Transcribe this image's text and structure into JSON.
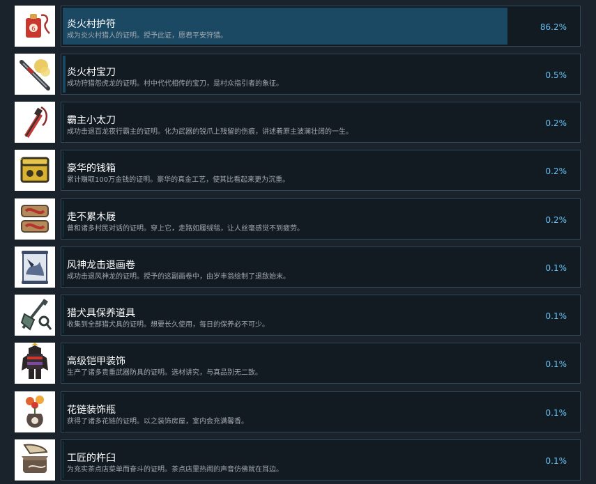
{
  "achievements": [
    {
      "title": "炎火村护符",
      "desc": "成为炎火村猎人的证明。授予此证，愿君平安狩猎。",
      "percent": "86.2%",
      "fill_fraction": 0.862,
      "icon": "red-charm-amulet-icon"
    },
    {
      "title": "炎火村宝刀",
      "desc": "成功狩猎怨虎龙的证明。村中代代相传的宝刀，是村众指引者的象征。",
      "percent": "0.5%",
      "fill_fraction": 0.005,
      "icon": "treasured-katana-icon"
    },
    {
      "title": "霸主小太刀",
      "desc": "成功击退百龙夜行霸主的证明。化为武器的锐爪上残留的伤痕，讲述着原主波澜壮阔的一生。",
      "percent": "0.2%",
      "fill_fraction": 0.002,
      "icon": "kodachi-blade-icon"
    },
    {
      "title": "豪华的钱箱",
      "desc": "累计赚取100万金钱的证明。豪华的真金工艺，使其比看起来更为沉重。",
      "percent": "0.2%",
      "fill_fraction": 0.002,
      "icon": "money-box-icon"
    },
    {
      "title": "走不累木屐",
      "desc": "曾和诸多村民对话的证明。穿上它，走路如履绒毯，让人丝毫感觉不到疲劳。",
      "percent": "0.2%",
      "fill_fraction": 0.002,
      "icon": "wooden-geta-icon"
    },
    {
      "title": "风神龙击退画卷",
      "desc": "成功击退风神龙的证明。授予的这副画卷中，由岁丰翁绘制了退敌始末。",
      "percent": "0.1%",
      "fill_fraction": 0.001,
      "icon": "painted-scroll-icon"
    },
    {
      "title": "猎犬具保养道具",
      "desc": "收集到全部猎犬具的证明。想要长久使用，每日的保养必不可少。",
      "percent": "0.1%",
      "fill_fraction": 0.001,
      "icon": "maintenance-tools-icon"
    },
    {
      "title": "高级铠甲装饰",
      "desc": "生产了诸多贵重武器防具的证明。选材讲究，与真品别无二致。",
      "percent": "0.1%",
      "fill_fraction": 0.001,
      "icon": "samurai-armor-icon"
    },
    {
      "title": "花链装饰瓶",
      "desc": "获得了诸多花链的证明。以之装饰房屋，室内会充满馨香。",
      "percent": "0.1%",
      "fill_fraction": 0.001,
      "icon": "flower-vase-icon"
    },
    {
      "title": "工匠的杵臼",
      "desc": "为充实茶点店菜单而奋斗的证明。茶点店里热闹的声音仿佛就在耳边。",
      "percent": "0.1%",
      "fill_fraction": 0.001,
      "icon": "mortar-pestle-icon"
    }
  ]
}
